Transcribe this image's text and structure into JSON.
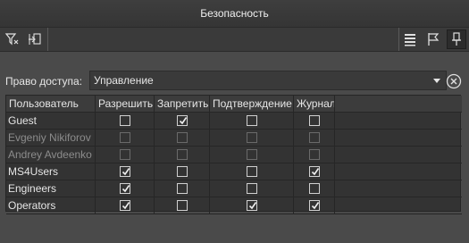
{
  "window": {
    "title": "Безопасность"
  },
  "toolbar": {
    "left_icons": [
      "filter-icon",
      "import-icon"
    ],
    "right_icons": [
      "list-icon",
      "flag-icon",
      "pin-icon"
    ]
  },
  "access": {
    "label": "Право доступа:",
    "selected": "Управление"
  },
  "table": {
    "columns": [
      "Пользователь",
      "Разрешить",
      "Запретить",
      "Подтверждение",
      "Журнал"
    ],
    "rows": [
      {
        "user": "Guest",
        "enabled": true,
        "allow": false,
        "deny": true,
        "confirm": false,
        "journal": false
      },
      {
        "user": "Evgeniy Nikiforov",
        "enabled": false,
        "allow": false,
        "deny": false,
        "confirm": false,
        "journal": false
      },
      {
        "user": "Andrey Avdeenko",
        "enabled": false,
        "allow": false,
        "deny": false,
        "confirm": false,
        "journal": false
      },
      {
        "user": "MS4Users",
        "enabled": true,
        "allow": true,
        "deny": false,
        "confirm": false,
        "journal": true
      },
      {
        "user": "Engineers",
        "enabled": true,
        "allow": true,
        "deny": false,
        "confirm": false,
        "journal": false
      },
      {
        "user": "Operators",
        "enabled": true,
        "allow": true,
        "deny": false,
        "confirm": true,
        "journal": true
      }
    ]
  }
}
